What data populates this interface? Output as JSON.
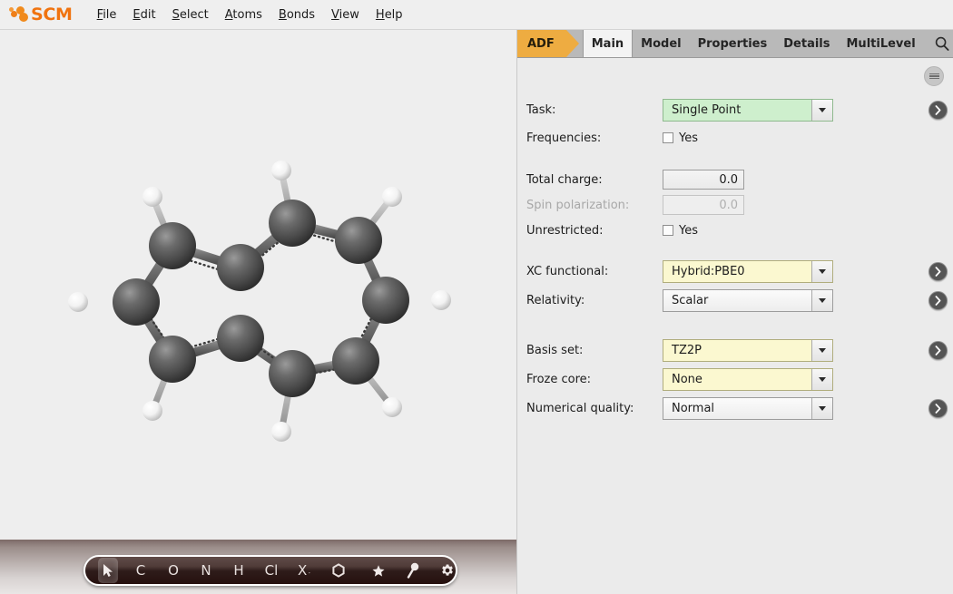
{
  "app": {
    "brand": "SCM",
    "menus": [
      {
        "label": "File",
        "mnemonic": "F"
      },
      {
        "label": "Edit",
        "mnemonic": "E"
      },
      {
        "label": "Select",
        "mnemonic": "S"
      },
      {
        "label": "Atoms",
        "mnemonic": "A"
      },
      {
        "label": "Bonds",
        "mnemonic": "B"
      },
      {
        "label": "View",
        "mnemonic": "V"
      },
      {
        "label": "Help",
        "mnemonic": "H"
      }
    ]
  },
  "panel": {
    "module_tab": "ADF",
    "tabs": [
      {
        "label": "Main",
        "selected": true
      },
      {
        "label": "Model",
        "selected": false
      },
      {
        "label": "Properties",
        "selected": false
      },
      {
        "label": "Details",
        "selected": false
      },
      {
        "label": "MultiLevel",
        "selected": false
      }
    ],
    "search_icon": "search-icon",
    "menu_icon": "hamburger-icon"
  },
  "form": {
    "task": {
      "label": "Task:",
      "value": "Single Point",
      "style": "green",
      "has_detail_button": true
    },
    "frequencies": {
      "label": "Frequencies:",
      "checkbox_label": "Yes",
      "checked": false
    },
    "total_charge": {
      "label": "Total charge:",
      "value": "0.0",
      "disabled": false
    },
    "spin_polarization": {
      "label": "Spin polarization:",
      "value": "0.0",
      "disabled": true
    },
    "unrestricted": {
      "label": "Unrestricted:",
      "checkbox_label": "Yes",
      "checked": false
    },
    "xc_functional": {
      "label": "XC functional:",
      "value": "Hybrid:PBE0",
      "style": "yellow",
      "has_detail_button": true
    },
    "relativity": {
      "label": "Relativity:",
      "value": "Scalar",
      "style": "plain",
      "has_detail_button": true
    },
    "basis_set": {
      "label": "Basis set:",
      "value": "TZ2P",
      "style": "yellow",
      "has_detail_button": true
    },
    "froze_core": {
      "label": "Froze core:",
      "value": "None",
      "style": "yellow",
      "has_detail_button": false
    },
    "numerical_quality": {
      "label": "Numerical quality:",
      "value": "Normal",
      "style": "plain",
      "has_detail_button": true
    }
  },
  "toolbar": {
    "tools": [
      {
        "name": "select-cursor-tool",
        "label": "",
        "icon": "cursor-arrow-icon",
        "active": true
      },
      {
        "name": "carbon-tool",
        "label": "C",
        "icon": "",
        "active": false
      },
      {
        "name": "oxygen-tool",
        "label": "O",
        "icon": "",
        "active": false
      },
      {
        "name": "nitrogen-tool",
        "label": "N",
        "icon": "",
        "active": false
      },
      {
        "name": "hydrogen-tool",
        "label": "H",
        "icon": "",
        "active": false
      },
      {
        "name": "chlorine-tool",
        "label": "Cl",
        "icon": "",
        "active": false
      },
      {
        "name": "other-element-tool",
        "label": "X",
        "icon": "chevron-down-icon",
        "active": false
      },
      {
        "name": "ring-tool",
        "label": "",
        "icon": "hexagon-icon",
        "active": false
      }
    ],
    "right_tools": [
      {
        "name": "favorites-tool",
        "icon": "star-icon"
      },
      {
        "name": "measure-tool",
        "icon": "lollipop-icon"
      },
      {
        "name": "preferences-tool",
        "icon": "gear-icon"
      }
    ]
  },
  "molecule": {
    "name": "azulene",
    "formula": "C10H8",
    "carbon_color": "#4d4d4d",
    "hydrogen_color": "#f2f2f2",
    "background": "#eeeeee"
  },
  "colors": {
    "accent": "#eeac41",
    "panel_bg": "#ebebeb",
    "tabbar_bg": "#b9b9b9",
    "combo_green": "#ceefcd",
    "combo_yellow": "#fbf8d0",
    "toolbar_dark": "#2e1c1a"
  }
}
